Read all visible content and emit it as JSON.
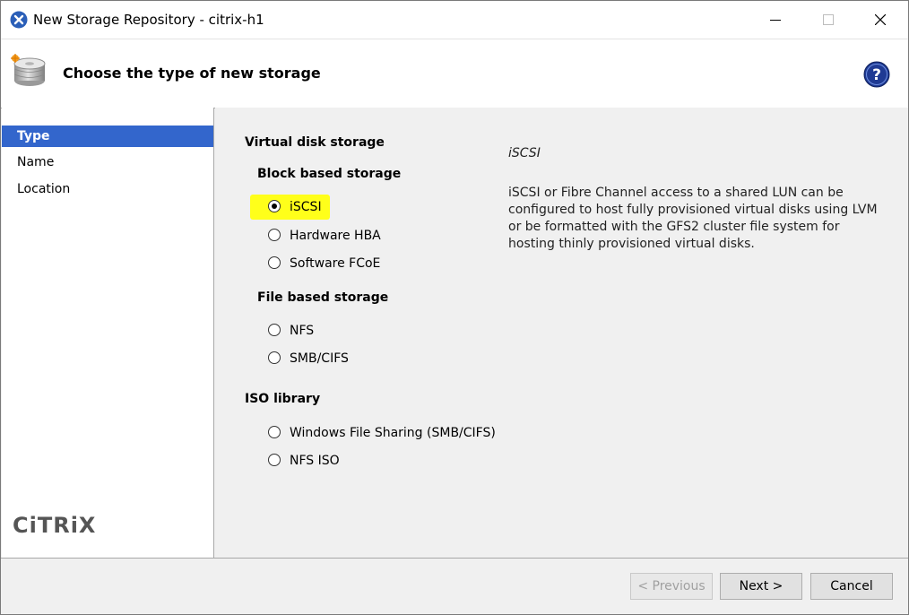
{
  "window": {
    "title": "New Storage Repository - citrix-h1"
  },
  "header": {
    "title": "Choose the type of new storage"
  },
  "sidebar": {
    "items": [
      {
        "label": "Type",
        "active": true
      },
      {
        "label": "Name",
        "active": false
      },
      {
        "label": "Location",
        "active": false
      }
    ],
    "logo_text": "CiTRiX"
  },
  "main": {
    "virtual_disk_title": "Virtual disk storage",
    "block_title": "Block based storage",
    "block_options": [
      "iSCSI",
      "Hardware HBA",
      "Software FCoE"
    ],
    "file_title": "File based storage",
    "file_options": [
      "NFS",
      "SMB/CIFS"
    ],
    "iso_title": "ISO library",
    "iso_options": [
      "Windows File Sharing (SMB/CIFS)",
      "NFS ISO"
    ],
    "selected": "iSCSI",
    "description_title": "iSCSI",
    "description_text": "iSCSI or Fibre Channel access to a shared LUN can be configured to host fully provisioned virtual disks using LVM or be formatted with the GFS2 cluster file system for hosting thinly provisioned virtual disks."
  },
  "footer": {
    "previous_label": "< Previous",
    "next_label": "Next >",
    "cancel_label": "Cancel"
  },
  "colors": {
    "selection_blue": "#3366cc",
    "highlight_yellow": "#ffff1a",
    "help_icon_blue": "#1f3a93"
  }
}
